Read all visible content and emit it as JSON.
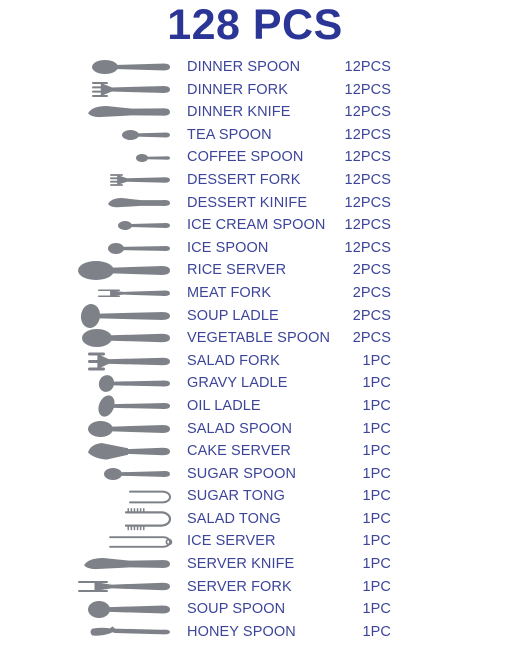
{
  "header": {
    "title": "128 PCS"
  },
  "colors": {
    "title": "#2b3596",
    "text": "#3c4599",
    "icon": "#7e8288",
    "background": "#ffffff"
  },
  "items": [
    {
      "icon": "dinner-spoon-icon",
      "label": "DINNER SPOON",
      "qty": "12PCS"
    },
    {
      "icon": "dinner-fork-icon",
      "label": "DINNER FORK",
      "qty": "12PCS"
    },
    {
      "icon": "dinner-knife-icon",
      "label": "DINNER KNIFE",
      "qty": "12PCS"
    },
    {
      "icon": "tea-spoon-icon",
      "label": "TEA SPOON",
      "qty": "12PCS"
    },
    {
      "icon": "coffee-spoon-icon",
      "label": "COFFEE SPOON",
      "qty": "12PCS"
    },
    {
      "icon": "dessert-fork-icon",
      "label": "DESSERT FORK",
      "qty": "12PCS"
    },
    {
      "icon": "dessert-knife-icon",
      "label": "DESSERT KINIFE",
      "qty": "12PCS"
    },
    {
      "icon": "ice-cream-spoon-icon",
      "label": "ICE CREAM SPOON",
      "qty": "12PCS"
    },
    {
      "icon": "ice-spoon-icon",
      "label": "ICE SPOON",
      "qty": "12PCS"
    },
    {
      "icon": "rice-server-icon",
      "label": "RICE SERVER",
      "qty": "2PCS"
    },
    {
      "icon": "meat-fork-icon",
      "label": "MEAT FORK",
      "qty": "2PCS"
    },
    {
      "icon": "soup-ladle-icon",
      "label": "SOUP LADLE",
      "qty": "2PCS"
    },
    {
      "icon": "vegetable-spoon-icon",
      "label": "VEGETABLE SPOON",
      "qty": "2PCS"
    },
    {
      "icon": "salad-fork-icon",
      "label": "SALAD FORK",
      "qty": "1PC"
    },
    {
      "icon": "gravy-ladle-icon",
      "label": "GRAVY LADLE",
      "qty": "1PC"
    },
    {
      "icon": "oil-ladle-icon",
      "label": "OIL LADLE",
      "qty": "1PC"
    },
    {
      "icon": "salad-spoon-icon",
      "label": "SALAD SPOON",
      "qty": "1PC"
    },
    {
      "icon": "cake-server-icon",
      "label": "CAKE SERVER",
      "qty": "1PC"
    },
    {
      "icon": "sugar-spoon-icon",
      "label": "SUGAR SPOON",
      "qty": "1PC"
    },
    {
      "icon": "sugar-tong-icon",
      "label": "SUGAR TONG",
      "qty": "1PC"
    },
    {
      "icon": "salad-tong-icon",
      "label": "SALAD TONG",
      "qty": "1PC"
    },
    {
      "icon": "ice-server-icon",
      "label": "ICE SERVER",
      "qty": "1PC"
    },
    {
      "icon": "server-knife-icon",
      "label": "SERVER KNIFE",
      "qty": "1PC"
    },
    {
      "icon": "server-fork-icon",
      "label": "SERVER FORK",
      "qty": "1PC"
    },
    {
      "icon": "soup-spoon-icon",
      "label": "SOUP SPOON",
      "qty": "1PC"
    },
    {
      "icon": "honey-spoon-icon",
      "label": "HONEY SPOON",
      "qty": "1PC"
    }
  ]
}
